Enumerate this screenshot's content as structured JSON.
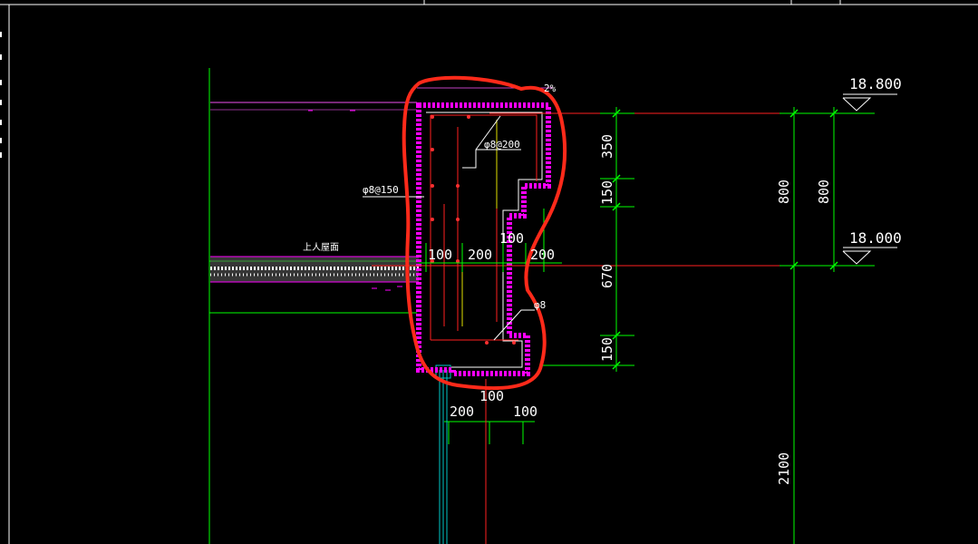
{
  "drawing": {
    "elevations": [
      "18.800",
      "18.000"
    ],
    "vertical_dimensions": [
      "350",
      "150",
      "670",
      "150",
      "800",
      "800",
      "2100"
    ],
    "horizontal_dimensions_top": [
      "100",
      "200",
      "100",
      "200"
    ],
    "horizontal_dimensions_bottom": [
      "100",
      "200",
      "100"
    ],
    "rebar_labels": [
      "φ8@200",
      "φ8@150",
      "φ8"
    ],
    "roof_label": "上人屋面",
    "slope_label": "2%"
  },
  "colors": {
    "background": "#000000",
    "frame": "#ffffff",
    "green": "#00ff00",
    "red": "#ff0000",
    "magenta": "#ff00ff",
    "markup": "#ff2a1a",
    "cyan": "#00c8c8"
  }
}
